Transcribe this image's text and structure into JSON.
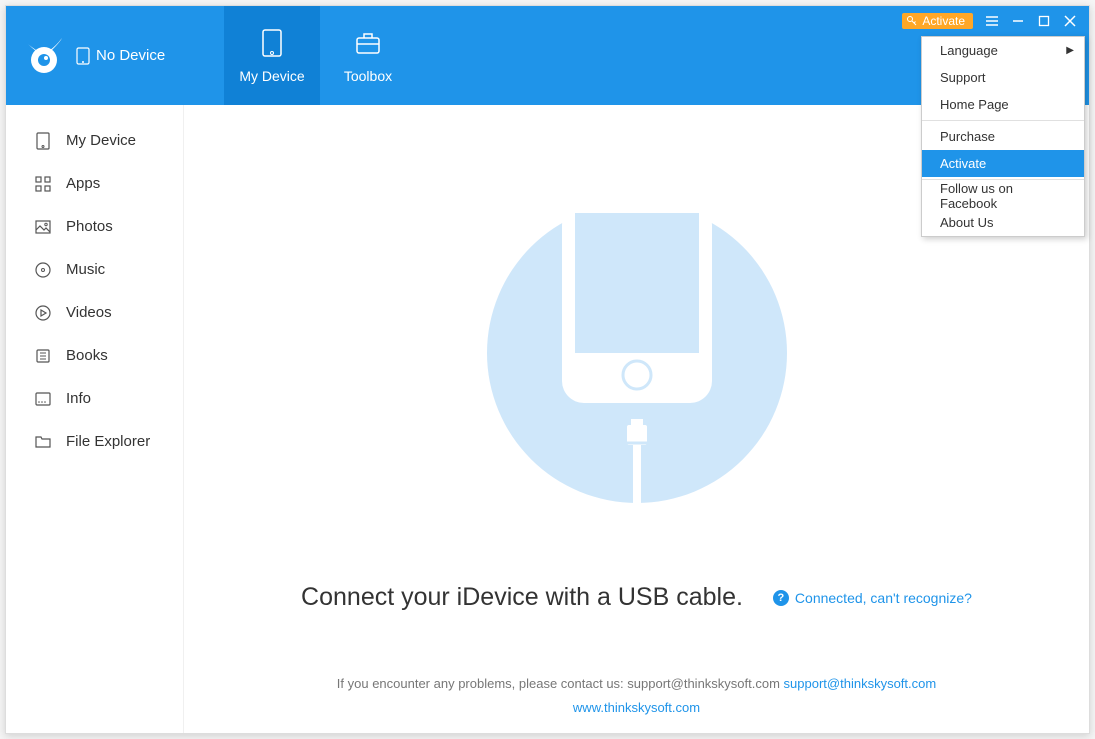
{
  "header": {
    "device_label": "No Device",
    "tabs": [
      {
        "label": "My Device"
      },
      {
        "label": "Toolbox"
      }
    ],
    "activate_label": "Activate"
  },
  "sidebar": {
    "items": [
      {
        "label": "My Device"
      },
      {
        "label": "Apps"
      },
      {
        "label": "Photos"
      },
      {
        "label": "Music"
      },
      {
        "label": "Videos"
      },
      {
        "label": "Books"
      },
      {
        "label": "Info"
      },
      {
        "label": "File Explorer"
      }
    ]
  },
  "main": {
    "prompt": "Connect your iDevice with a USB cable.",
    "help_link": "Connected, can't recognize?"
  },
  "footer": {
    "line1_prefix": "If you encounter any problems, please contact us: support@thinkskysoft.com ",
    "email_link": "support@thinkskysoft.com",
    "website": "www.thinkskysoft.com"
  },
  "menu": {
    "items": [
      {
        "label": "Language",
        "has_submenu": true
      },
      {
        "label": "Support"
      },
      {
        "label": "Home Page"
      },
      {
        "sep": true
      },
      {
        "label": "Purchase"
      },
      {
        "label": "Activate",
        "highlighted": true
      },
      {
        "sep": true
      },
      {
        "label": "Follow us on Facebook"
      },
      {
        "label": "About Us"
      }
    ]
  },
  "colors": {
    "primary": "#1f94e9",
    "primary_dark": "#1081d6",
    "accent": "#ffa726"
  }
}
